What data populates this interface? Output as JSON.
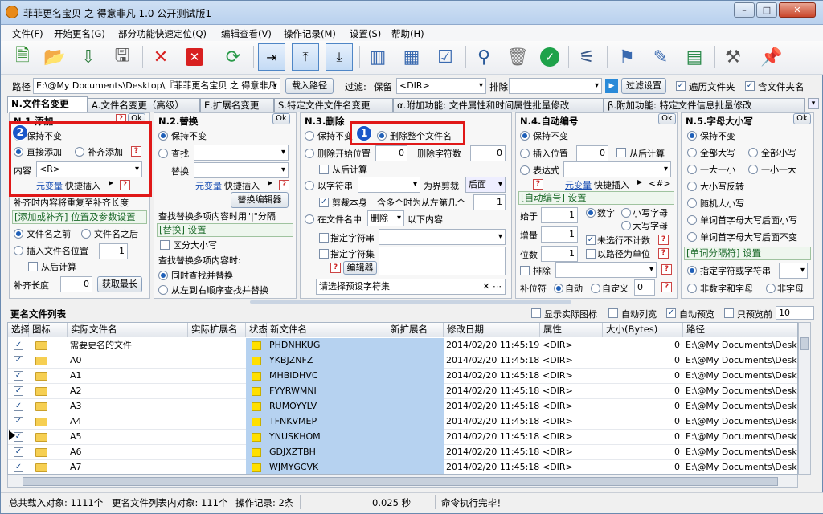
{
  "window": {
    "title": "菲菲更名宝贝 之 得意非凡 1.0 公开测试版1"
  },
  "menu": [
    "文件(F)",
    "开始更名(G)",
    "部分功能快速定位(Q)",
    "编辑查看(V)",
    "操作记录(M)",
    "设置(S)",
    "帮助(H)"
  ],
  "pathbar": {
    "path_label": "路径",
    "path_value": "E:\\@My Documents\\Desktop\\『菲菲更名宝贝 之 得意非凡",
    "load_button": "载入路径",
    "filter_label": "过滤:",
    "keep_label": "保留",
    "keep_value": "<DIR>",
    "exclude_label": "排除",
    "exclude_value": "",
    "filter_button": "过滤设置",
    "traverse_label": "遍历文件夹",
    "include_folder_label": "含文件夹名"
  },
  "tabs": [
    "N.文件名变更",
    "A.文件名变更（高级）",
    "E.扩展名变更",
    "S.特定文件文件名变更",
    "α.附加功能: 文件属性和时间属性批量修改",
    "β.附加功能: 特定文件信息批量修改"
  ],
  "ok": "Ok",
  "p1": {
    "title": "N.1.添加",
    "keep": "保持不变",
    "direct": "直接添加",
    "pad": "补齐添加",
    "content_label": "内容",
    "content_value": "<R>",
    "var_link": "元变量",
    "quick": "快捷插入",
    "note": "补齐时内容将重复至补齐长度",
    "sect": "[添加或补齐] 位置及参数设置",
    "before": "文件名之前",
    "after": "文件名之后",
    "insert": "插入文件名位置",
    "insert_val": "1",
    "from_end": "从后计算",
    "pad_len": "补齐长度",
    "pad_val": "0",
    "get_longest": "获取最长"
  },
  "p2": {
    "title": "N.2.替换",
    "keep": "保持不变",
    "find": "查找",
    "replace": "替换",
    "var_link": "元变量",
    "quick": "快捷插入",
    "editor": "替换编辑器",
    "hint": "查找替换多项内容时用\"|\"分隔",
    "sect": "[替换] 设置",
    "case": "区分大小写",
    "multi": "查找替换多项内容时:",
    "simul": "同时查找并替换",
    "ltr": "从左到右顺序查找并替换"
  },
  "p3": {
    "title": "N.3.删除",
    "keep": "保持不变",
    "whole": "删除整个文件名",
    "del_start": "删除开始位置",
    "del_start_val": "0",
    "del_count": "删除字符数",
    "del_count_val": "0",
    "from_end": "从后计算",
    "by_char": "以字符串",
    "boundary": "为界剪裁",
    "after_opt": "后面",
    "cut_self": "剪裁本身",
    "multi_left": "含多个时为从左第几个",
    "multi_val": "1",
    "in_name": "在文件名中",
    "del_opt": "删除",
    "after_content": "以下内容",
    "spec_str": "指定字符串",
    "spec_set": "指定字符集",
    "editor": "编辑器",
    "preset": "请选择预设字符集"
  },
  "p4": {
    "title": "N.4.自动编号",
    "keep": "保持不变",
    "insert_pos": "插入位置",
    "insert_val": "0",
    "from_end": "从后计算",
    "expr": "表达式",
    "var_link": "元变量",
    "quick": "快捷插入",
    "hash": "<#>",
    "sect": "[自动编号] 设置",
    "start": "始于",
    "start_val": "1",
    "inc": "增量",
    "inc_val": "1",
    "digits": "位数",
    "digits_val": "1",
    "number": "数字",
    "lower": "小写字母",
    "upper": "大写字母",
    "skip": "未选行不计数",
    "path_unit": "以路径为单位",
    "exclude": "排除",
    "pad_char": "补位符",
    "auto": "自动",
    "custom": "自定义",
    "custom_val": "0"
  },
  "p5": {
    "title": "N.5.字母大小写",
    "keep": "保持不变",
    "all_upper": "全部大写",
    "all_lower": "全部小写",
    "one_upper": "一大一小",
    "one_lower": "一小一大",
    "invert": "大小写反转",
    "random": "随机大小写",
    "word_upper": "单词首字母大写后面小写",
    "word_keep": "单词首字母大写后面不变",
    "sect": "[单词分隔符] 设置",
    "spec": "指定字符或字符串",
    "non_alnum": "非数字和字母",
    "non_char": "非字母"
  },
  "list": {
    "title": "更名文件列表",
    "show_icon": "显示实际图标",
    "auto_width": "自动列宽",
    "auto_preview": "自动预览",
    "preview_first": "只预览前",
    "preview_n": "10",
    "columns": [
      "选择",
      "图标",
      "实际文件名",
      "实际扩展名",
      "状态",
      "新文件名",
      "新扩展名",
      "修改日期",
      "属性",
      "大小(Bytes)",
      "路径"
    ],
    "rows": [
      {
        "name": "需要更名的文件",
        "new": "PHDNHKUG",
        "date": "2014/02/20 11:45:19",
        "attr": "<DIR>",
        "size": "0",
        "path": "E:\\@My Documents\\Desktop"
      },
      {
        "name": "A0",
        "new": "YKBJZNFZ",
        "date": "2014/02/20 11:45:18",
        "attr": "<DIR>",
        "size": "0",
        "path": "E:\\@My Documents\\Desktop"
      },
      {
        "name": "A1",
        "new": "MHBIDHVC",
        "date": "2014/02/20 11:45:18",
        "attr": "<DIR>",
        "size": "0",
        "path": "E:\\@My Documents\\Desktop"
      },
      {
        "name": "A2",
        "new": "FYYRWMNI",
        "date": "2014/02/20 11:45:18",
        "attr": "<DIR>",
        "size": "0",
        "path": "E:\\@My Documents\\Desktop"
      },
      {
        "name": "A3",
        "new": "RUMOYYLV",
        "date": "2014/02/20 11:45:18",
        "attr": "<DIR>",
        "size": "0",
        "path": "E:\\@My Documents\\Desktop"
      },
      {
        "name": "A4",
        "new": "TFNKVMEP",
        "date": "2014/02/20 11:45:18",
        "attr": "<DIR>",
        "size": "0",
        "path": "E:\\@My Documents\\Desktop"
      },
      {
        "name": "A5",
        "new": "YNUSKHOM",
        "date": "2014/02/20 11:45:18",
        "attr": "<DIR>",
        "size": "0",
        "path": "E:\\@My Documents\\Desktop"
      },
      {
        "name": "A6",
        "new": "GDJXZTBH",
        "date": "2014/02/20 11:45:18",
        "attr": "<DIR>",
        "size": "0",
        "path": "E:\\@My Documents\\Desktop"
      },
      {
        "name": "A7",
        "new": "WJMYGCVK",
        "date": "2014/02/20 11:45:18",
        "attr": "<DIR>",
        "size": "0",
        "path": "E:\\@My Documents\\Desktop"
      }
    ]
  },
  "status": {
    "total": "总共载入对象: 1111个",
    "in_list": "更名文件列表内对象: 111个",
    "ops": "操作记录: 2条",
    "time": "0.025 秒",
    "msg": "命令执行完毕！"
  },
  "callouts": {
    "one": "1",
    "two": "2"
  }
}
